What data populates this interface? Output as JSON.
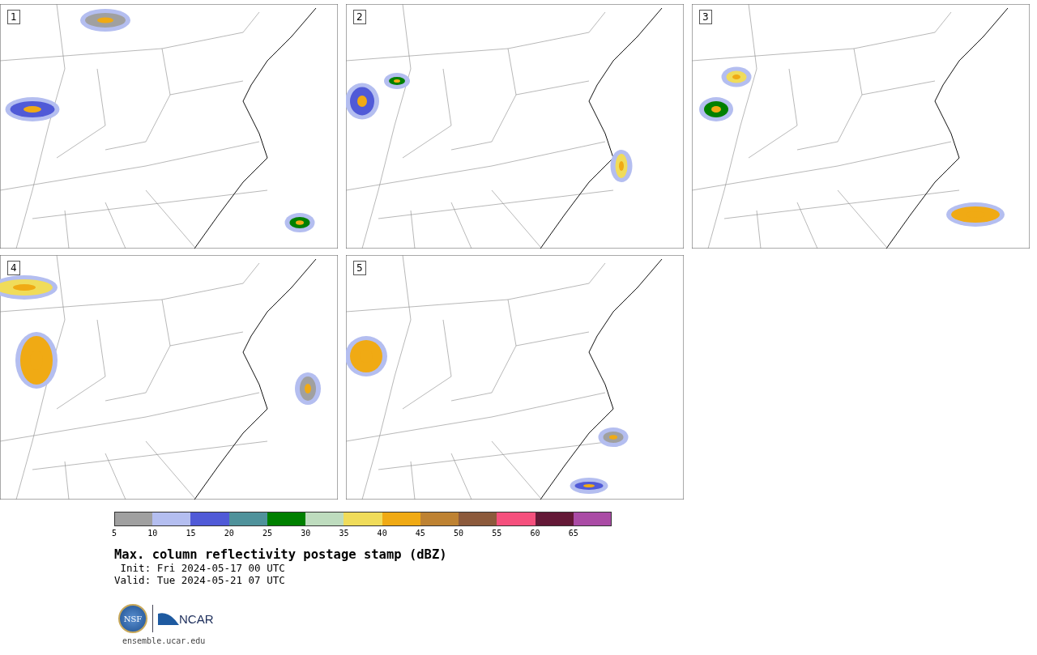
{
  "panels": [
    {
      "label": "1"
    },
    {
      "label": "2"
    },
    {
      "label": "3"
    },
    {
      "label": "4"
    },
    {
      "label": "5"
    }
  ],
  "colorbar": {
    "segments": [
      {
        "color": "#a0a0a0",
        "tick": "5"
      },
      {
        "color": "#b4bef0",
        "tick": "10"
      },
      {
        "color": "#505ad7",
        "tick": "15"
      },
      {
        "color": "#4f929b",
        "tick": "20"
      },
      {
        "color": "#008000",
        "tick": "25"
      },
      {
        "color": "#bedcbe",
        "tick": "30"
      },
      {
        "color": "#f0dc5a",
        "tick": "35"
      },
      {
        "color": "#f0aa14",
        "tick": "40"
      },
      {
        "color": "#be8232",
        "tick": "45"
      },
      {
        "color": "#8c5a3c",
        "tick": "50"
      },
      {
        "color": "#f5507d",
        "tick": "55"
      },
      {
        "color": "#641937",
        "tick": "60"
      },
      {
        "color": "#aa4ba5",
        "tick": "65"
      }
    ]
  },
  "title": "Max. column reflectivity postage stamp (dBZ)",
  "init": " Init: Fri 2024-05-17 00 UTC",
  "valid": "Valid: Tue 2024-05-21 07 UTC",
  "logo": {
    "left": "NSF",
    "right": "NCAR"
  },
  "url": "ensemble.ucar.edu"
}
